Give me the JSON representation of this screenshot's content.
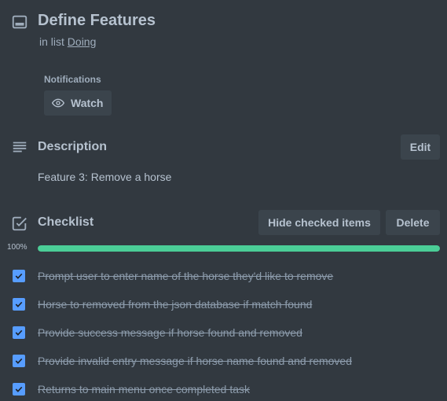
{
  "card": {
    "title": "Define Features",
    "in_list_prefix": "in list",
    "list_name": "Doing"
  },
  "notifications": {
    "label": "Notifications",
    "watch_label": "Watch"
  },
  "description": {
    "title": "Description",
    "edit_label": "Edit",
    "text": "Feature 3: Remove a horse"
  },
  "checklist": {
    "title": "Checklist",
    "hide_label": "Hide checked items",
    "delete_label": "Delete",
    "percent_label": "100%",
    "progress": 1.0,
    "items": [
      {
        "text": "Prompt user to enter name of the horse they'd like to remove",
        "checked": true
      },
      {
        "text": "Horse to removed from the json database if match found",
        "checked": true
      },
      {
        "text": "Provide success message if horse found and removed",
        "checked": true
      },
      {
        "text": "Provide invalid entry message if horse name found and removed",
        "checked": true
      },
      {
        "text": "Returns to main menu once completed task",
        "checked": true
      }
    ]
  },
  "colors": {
    "background": "#323940",
    "button": "#3b444c",
    "progress": "#4bce97",
    "checkbox": "#579dff"
  },
  "icons": [
    "card-icon",
    "eye-icon",
    "description-icon",
    "checklist-icon",
    "checkmark-icon"
  ]
}
